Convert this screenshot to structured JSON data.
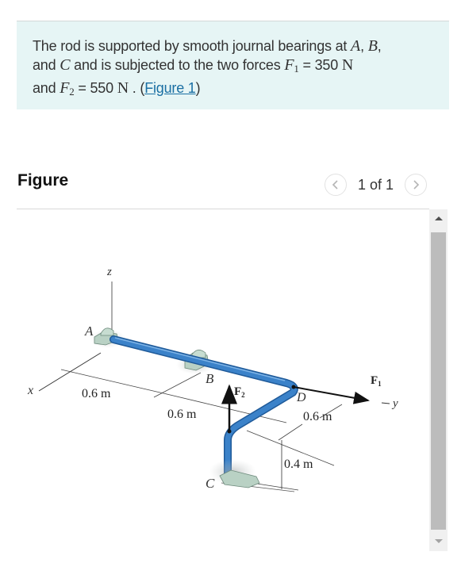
{
  "problem": {
    "text_1": "The rod is supported by smooth journal bearings at ",
    "A": "A",
    "comma_1": ", ",
    "B": "B",
    "comma_2": ",",
    "and_1": "and ",
    "C": "C",
    "text_2": " and is subjected to the two forces ",
    "F1_symbol": "F",
    "F1_sub": "1",
    "eq_1": " = 350 ",
    "unit_1": "N",
    "and_2": "and ",
    "F2_symbol": "F",
    "F2_sub": "2",
    "eq_2": " = 550 ",
    "unit_2": "N",
    "period": " . (",
    "figure_link": "Figure 1",
    "close_paren": ")"
  },
  "figure_panel": {
    "title": "Figure",
    "pager_text": "1 of 1",
    "prev_icon": "chevron-left-icon",
    "next_icon": "chevron-right-icon"
  },
  "diagram": {
    "labels": {
      "z_axis": "z",
      "x_axis": "x",
      "y_axis": "y",
      "A": "A",
      "B": "B",
      "C": "C",
      "D": "D",
      "F1": "F",
      "F1_sub": "1",
      "F2": "F",
      "F2_sub": "2"
    },
    "dimensions": {
      "AB": "0.6 m",
      "B_to_bend": "0.6 m",
      "D_to_corner": "0.6 m",
      "vertical": "0.4 m"
    },
    "colors": {
      "rod": "#3b82c9",
      "rod_dark": "#1f5a99",
      "bearing": "#b9d1c4",
      "arrow": "#111111"
    }
  }
}
